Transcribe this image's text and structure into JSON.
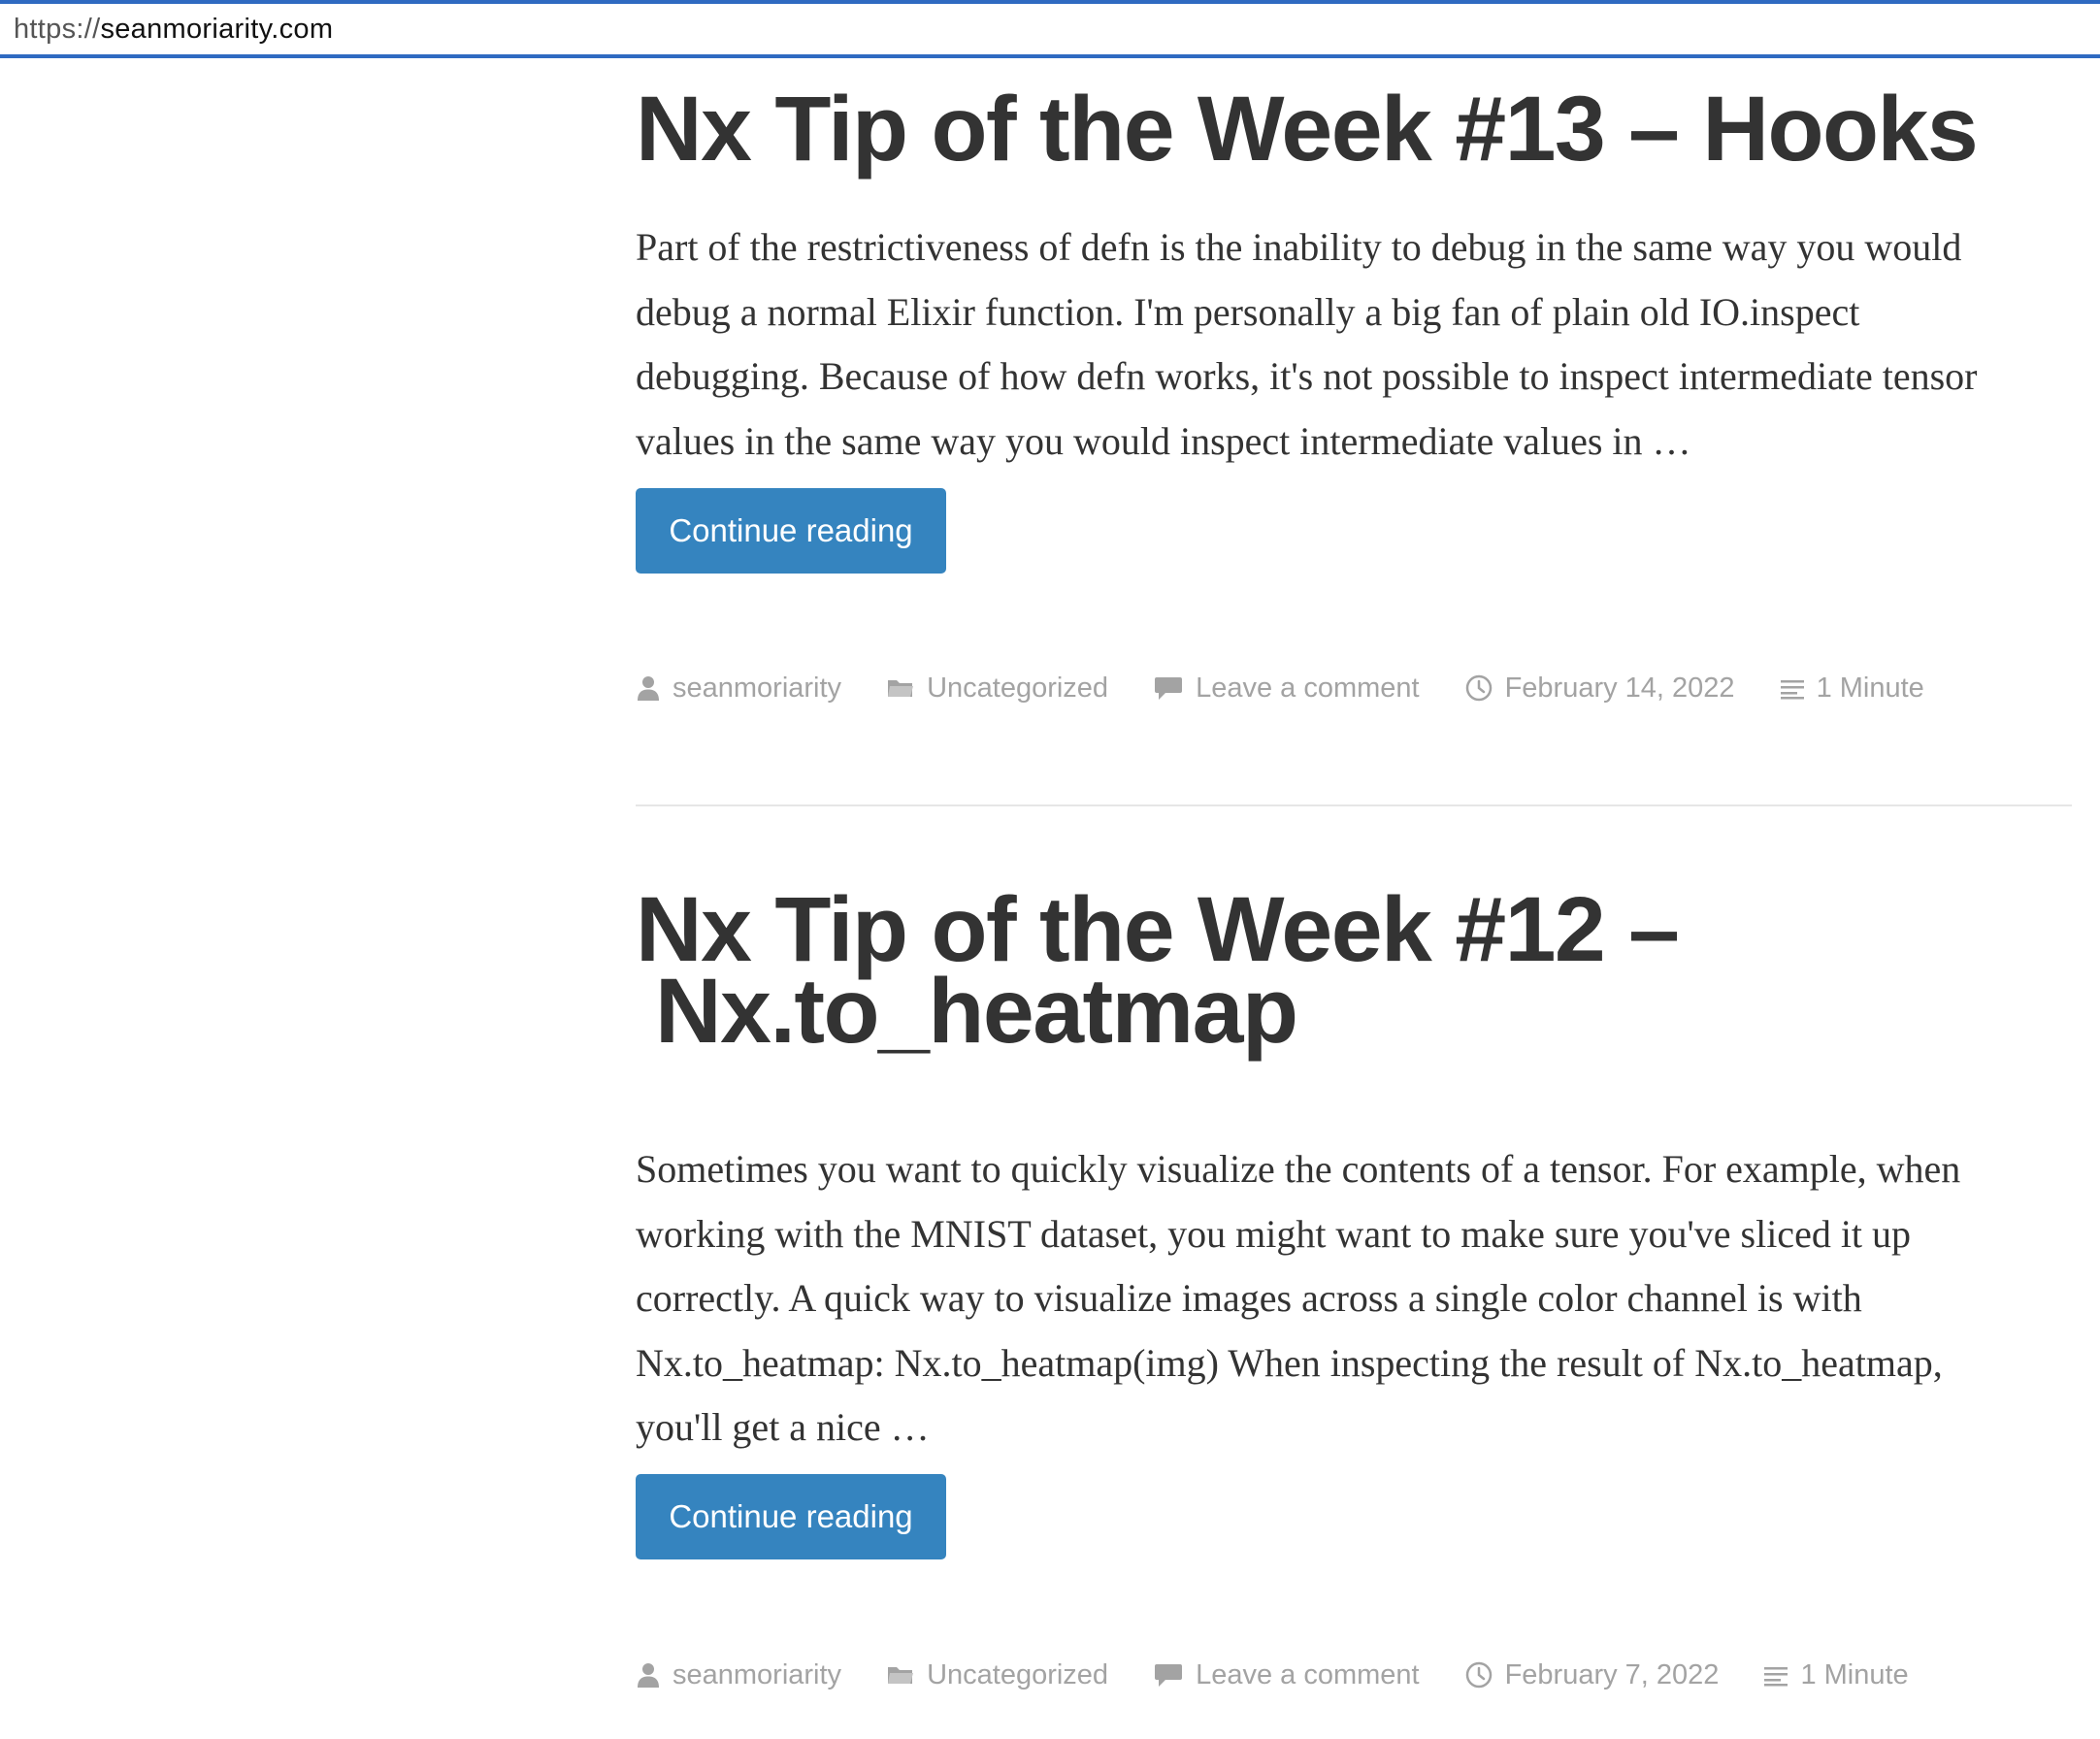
{
  "browser": {
    "url_scheme": "https://",
    "url_host": "seanmoriarity.com"
  },
  "posts": [
    {
      "title_lines": [
        "Nx Tip of the Week #13 – Hooks"
      ],
      "excerpt_lines": [
        "Part of the restrictiveness of defn is the inability to debug in the same way you would",
        "debug a normal Elixir function. I'm personally a big fan of plain old IO.inspect",
        "debugging. Because of how defn works, it's not possible to inspect intermediate tensor",
        "values in the same way you would inspect intermediate values in …"
      ],
      "button_label": "Continue reading",
      "meta": {
        "author": "seanmoriarity",
        "category": "Uncategorized",
        "comments": "Leave a comment",
        "date": "February 14, 2022",
        "reading_time": "1 Minute"
      }
    },
    {
      "title_lines": [
        "Nx Tip of the Week #12 –",
        "Nx.to_heatmap"
      ],
      "excerpt_lines": [
        "Sometimes you want to quickly visualize the contents of a tensor. For example, when",
        "working with the MNIST dataset, you might want to make sure you've sliced it up",
        "correctly. A quick way to visualize images across a single color channel is with",
        "Nx.to_heatmap: Nx.to_heatmap(img) When inspecting the result of Nx.to_heatmap,",
        "you'll get a nice …"
      ],
      "button_label": "Continue reading",
      "meta": {
        "author": "seanmoriarity",
        "category": "Uncategorized",
        "comments": "Leave a comment",
        "date": "February 7, 2022",
        "reading_time": "1 Minute"
      }
    }
  ],
  "colors": {
    "accent_button": "#3584bf",
    "url_bar_border": "#2f6ac1",
    "meta_text": "#a3a3a3",
    "heading_text": "#333333"
  },
  "icons": {
    "author": "person-icon",
    "category": "folder-icon",
    "comments": "speech-bubble-icon",
    "date": "clock-icon",
    "reading_time": "lines-icon"
  }
}
